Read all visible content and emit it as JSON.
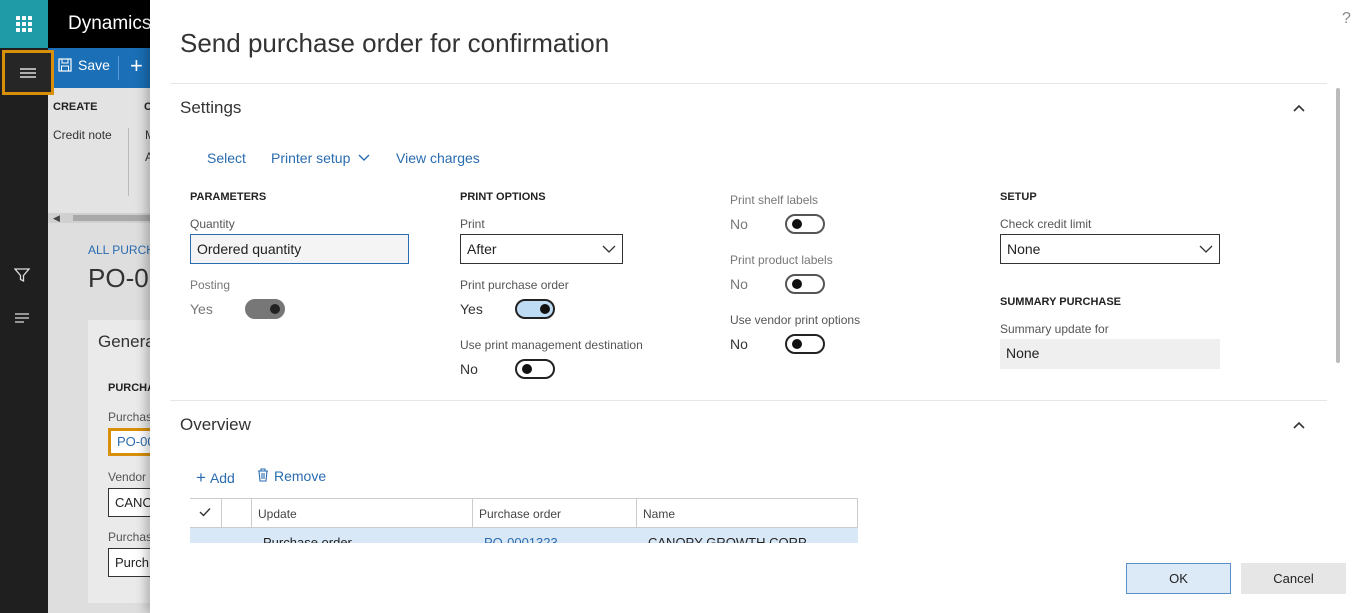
{
  "app": {
    "title": "Dynamics"
  },
  "background": {
    "save_label": "Save",
    "plus_label": "+",
    "create_label": "CREATE",
    "c2_label": "C",
    "credit_note": "Credit note",
    "m_label": "M",
    "a_label": "A",
    "breadcrumb": "ALL PURCHA",
    "po_title": "PO-0",
    "general": "Genera",
    "purch_head": "PURCHA",
    "purch_label": "Purchas",
    "po_link": "PO-00",
    "vendor_label": "Vendor",
    "vendor_value": "CANO",
    "purch_label2": "Purchas",
    "purch_value": "Purch"
  },
  "dialog": {
    "title": "Send purchase order for confirmation",
    "help": "?",
    "settings": {
      "title": "Settings",
      "actions": {
        "select": "Select",
        "printer_setup": "Printer setup",
        "view_charges": "View charges"
      },
      "parameters": {
        "heading": "PARAMETERS",
        "quantity_label": "Quantity",
        "quantity_value": "Ordered quantity",
        "posting_label": "Posting",
        "posting_value": "Yes"
      },
      "print_options": {
        "heading": "PRINT OPTIONS",
        "print_label": "Print",
        "print_value": "After",
        "print_po_label": "Print purchase order",
        "print_po_value": "Yes",
        "use_pm_label": "Use print management destination",
        "use_pm_value": "No"
      },
      "labels": {
        "shelf_label": "Print shelf labels",
        "shelf_value": "No",
        "product_label": "Print product labels",
        "product_value": "No",
        "vendor_print_label": "Use vendor print options",
        "vendor_print_value": "No"
      },
      "setup": {
        "heading": "SETUP",
        "credit_label": "Check credit limit",
        "credit_value": "None",
        "summary_heading": "SUMMARY PURCHASE",
        "summary_label": "Summary update for",
        "summary_value": "None"
      }
    },
    "overview": {
      "title": "Overview",
      "add_label": "Add",
      "remove_label": "Remove",
      "columns": [
        "Update",
        "Purchase order",
        "Name"
      ],
      "rows": [
        {
          "update": "Purchase order",
          "purchase_order": "PO-0001323",
          "name": "CANOPY GROWTH CORP"
        }
      ]
    },
    "buttons": {
      "ok": "OK",
      "cancel": "Cancel"
    }
  },
  "colors": {
    "accent": "#2a6cb0",
    "highlight": "#d88f09",
    "waffle": "#1e9ba7",
    "actionbar": "#1a6fb6"
  }
}
